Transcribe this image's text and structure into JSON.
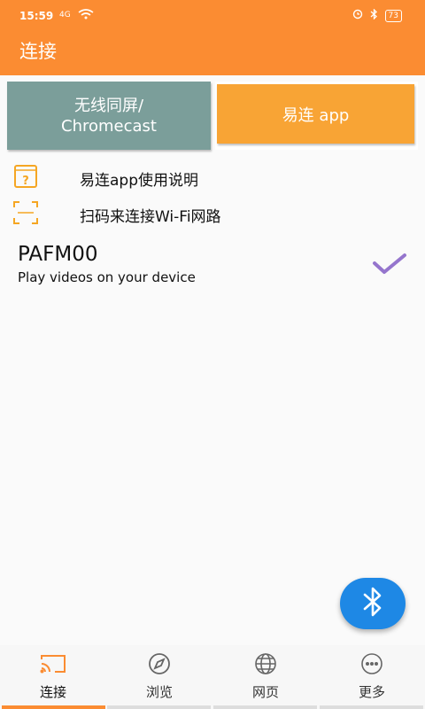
{
  "status_bar": {
    "time": "15:59",
    "signal": "4G",
    "battery": "73"
  },
  "app_bar": {
    "title": "连接"
  },
  "tabs": {
    "cast_line1": "无线同屏/",
    "cast_line2": "Chromecast",
    "app": "易连 app"
  },
  "menu": [
    {
      "icon": "help-book-icon",
      "label": "易连app使用说明"
    },
    {
      "icon": "scan-frame-icon",
      "label": "扫码来连接Wi-Fi网路"
    }
  ],
  "device": {
    "name": "PAFM00",
    "description": "Play videos on your device"
  },
  "nav": [
    {
      "icon": "cast-icon",
      "label": "连接"
    },
    {
      "icon": "compass-icon",
      "label": "浏览"
    },
    {
      "icon": "globe-icon",
      "label": "网页"
    },
    {
      "icon": "more-icon",
      "label": "更多"
    }
  ],
  "colors": {
    "primary": "#fb8c32",
    "cast_tab": "#7b9e9a",
    "app_tab": "#f8a435",
    "fab": "#1e88e5",
    "check": "#9575cd"
  }
}
